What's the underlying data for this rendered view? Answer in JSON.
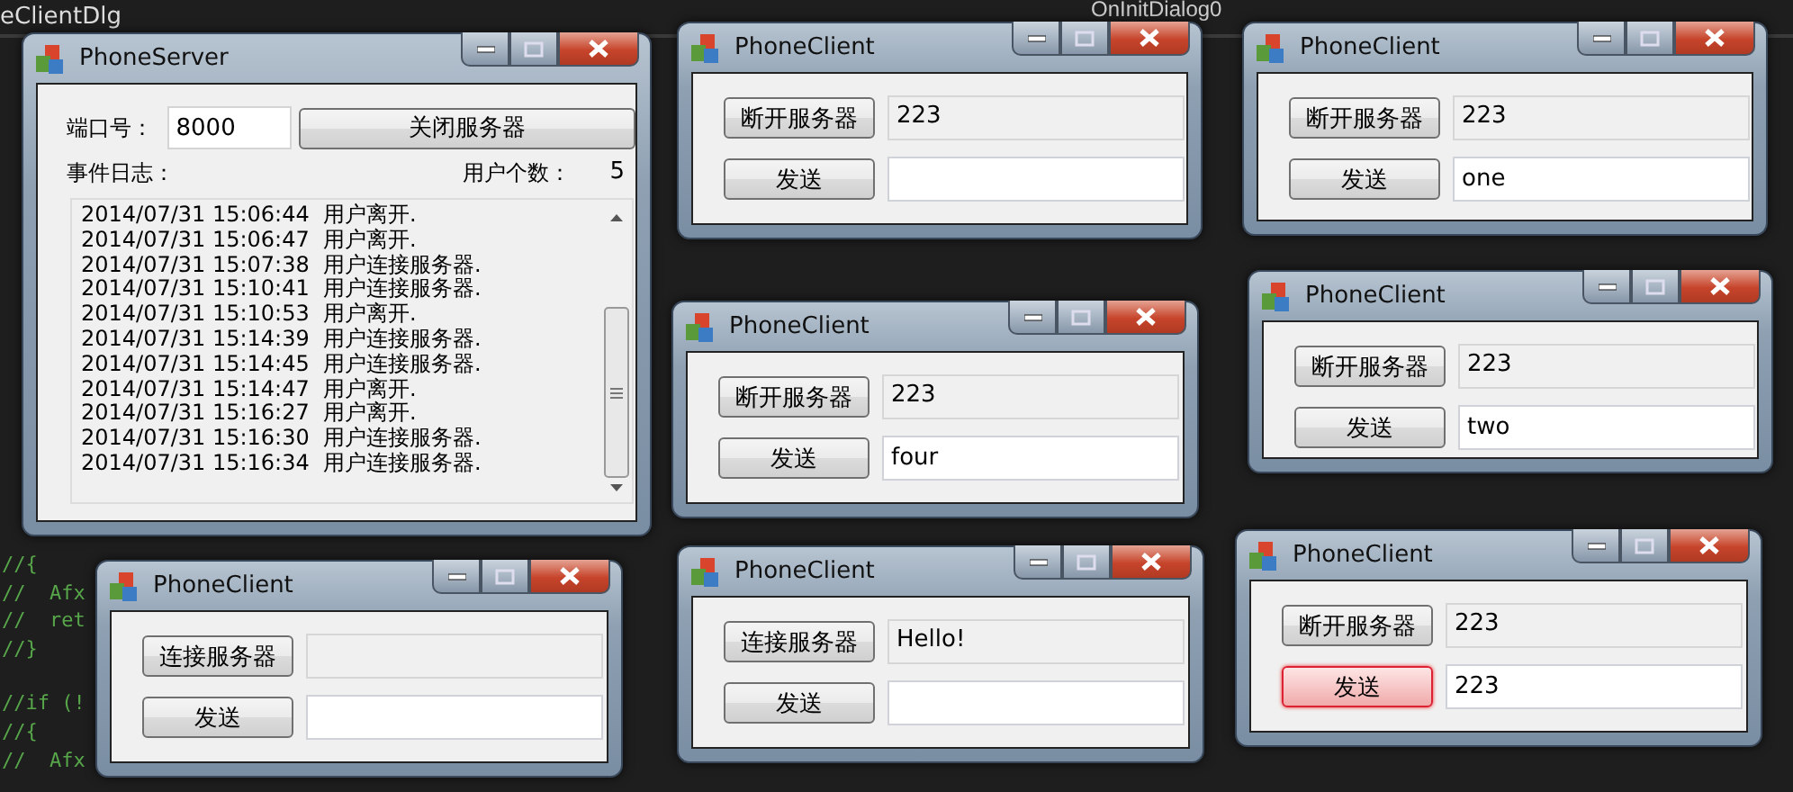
{
  "editor": {
    "tab": "eClientDlg",
    "member_dropdown": "OnInitDialog0",
    "code_lines": [
      "//{",
      "//  Afx",
      "//  ret",
      "//}",
      "//if (!",
      "//{",
      "//  Afx"
    ]
  },
  "windows": [
    {
      "kind": "server",
      "title": "PhoneServer",
      "port_label": "端口号：",
      "port": "8000",
      "close_button": "关闭服务器",
      "log_label": "事件日志：",
      "user_count_label": "用户个数：",
      "user_count": "5",
      "log": [
        "2014/07/31 15:06:44  用户离开.",
        "2014/07/31 15:06:47  用户离开.",
        "2014/07/31 15:07:38  用户连接服务器.",
        "2014/07/31 15:10:41  用户连接服务器.",
        "2014/07/31 15:10:53  用户离开.",
        "2014/07/31 15:14:39  用户连接服务器.",
        "2014/07/31 15:14:45  用户连接服务器.",
        "2014/07/31 15:14:47  用户离开.",
        "2014/07/31 15:16:27  用户离开.",
        "2014/07/31 15:16:30  用户连接服务器.",
        "2014/07/31 15:16:34  用户连接服务器."
      ]
    },
    {
      "kind": "client",
      "title": "PhoneClient",
      "connect_button": "断开服务器",
      "received": "223",
      "send_button": "发送",
      "send_focused": false
    },
    {
      "kind": "client",
      "title": "PhoneClient",
      "connect_button": "断开服务器",
      "received": "223",
      "send_button": "发送",
      "message": "one",
      "send_focused": false
    },
    {
      "kind": "client",
      "title": "PhoneClient",
      "connect_button": "断开服务器",
      "received": "223",
      "send_button": "发送",
      "message": "two",
      "send_focused": false
    },
    {
      "kind": "client",
      "title": "PhoneClient",
      "connect_button": "断开服务器",
      "received": "223",
      "send_button": "发送",
      "message": "four",
      "send_focused": false
    },
    {
      "kind": "client",
      "title": "PhoneClient",
      "connect_button": "连接服务器",
      "received": "Hello!",
      "send_button": "发送",
      "send_focused": false
    },
    {
      "kind": "client",
      "title": "PhoneClient",
      "connect_button": "断开服务器",
      "received": "223",
      "send_button": "发送",
      "message": "223",
      "send_focused": true
    },
    {
      "kind": "client",
      "title": "PhoneClient",
      "connect_button": "连接服务器",
      "send_button": "发送",
      "send_focused": false
    }
  ]
}
